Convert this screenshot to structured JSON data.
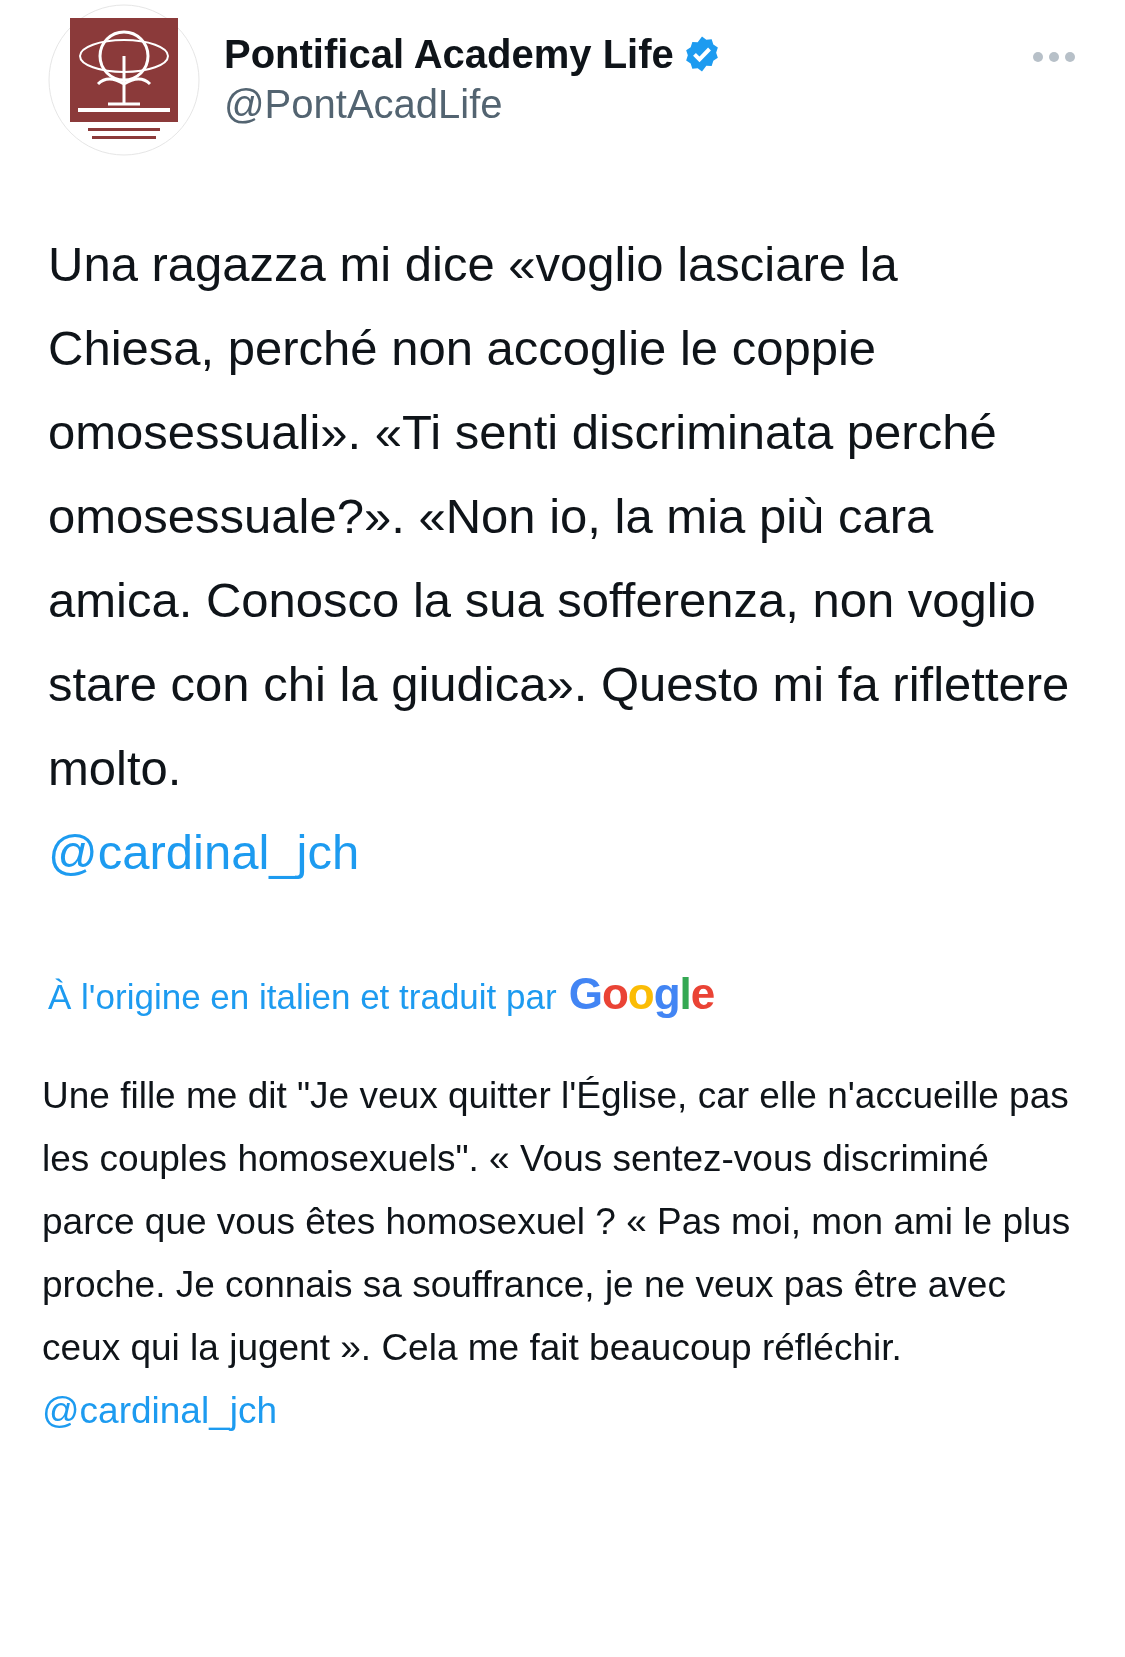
{
  "author": {
    "name": "Pontifical Academy Life",
    "verified": true,
    "handle": "@PontAcadLife"
  },
  "tweet": {
    "text": "Una ragazza mi dice «voglio lasciare la Chiesa, perché non accoglie le coppie omosessuali».  «Ti senti discriminata perché omosessuale?». «Non io, la mia più cara amica. Conosco la sua sofferenza, non voglio stare con chi la giudica». Questo mi fa riflettere molto.",
    "mention": "@cardinal_jch"
  },
  "translation": {
    "label": "À l'origine en italien et traduit par",
    "provider": "Google",
    "text": "Une fille me dit \"Je veux quitter l'Église, car elle n'accueille pas les couples homosexuels\". « Vous sentez-vous discriminé parce que vous êtes homosexuel ? « Pas moi, mon ami le plus proche. Je connais sa souffrance, je ne veux pas être avec ceux qui la jugent ». Cela me fait beaucoup réfléchir.",
    "mention": "@cardinal_jch"
  }
}
